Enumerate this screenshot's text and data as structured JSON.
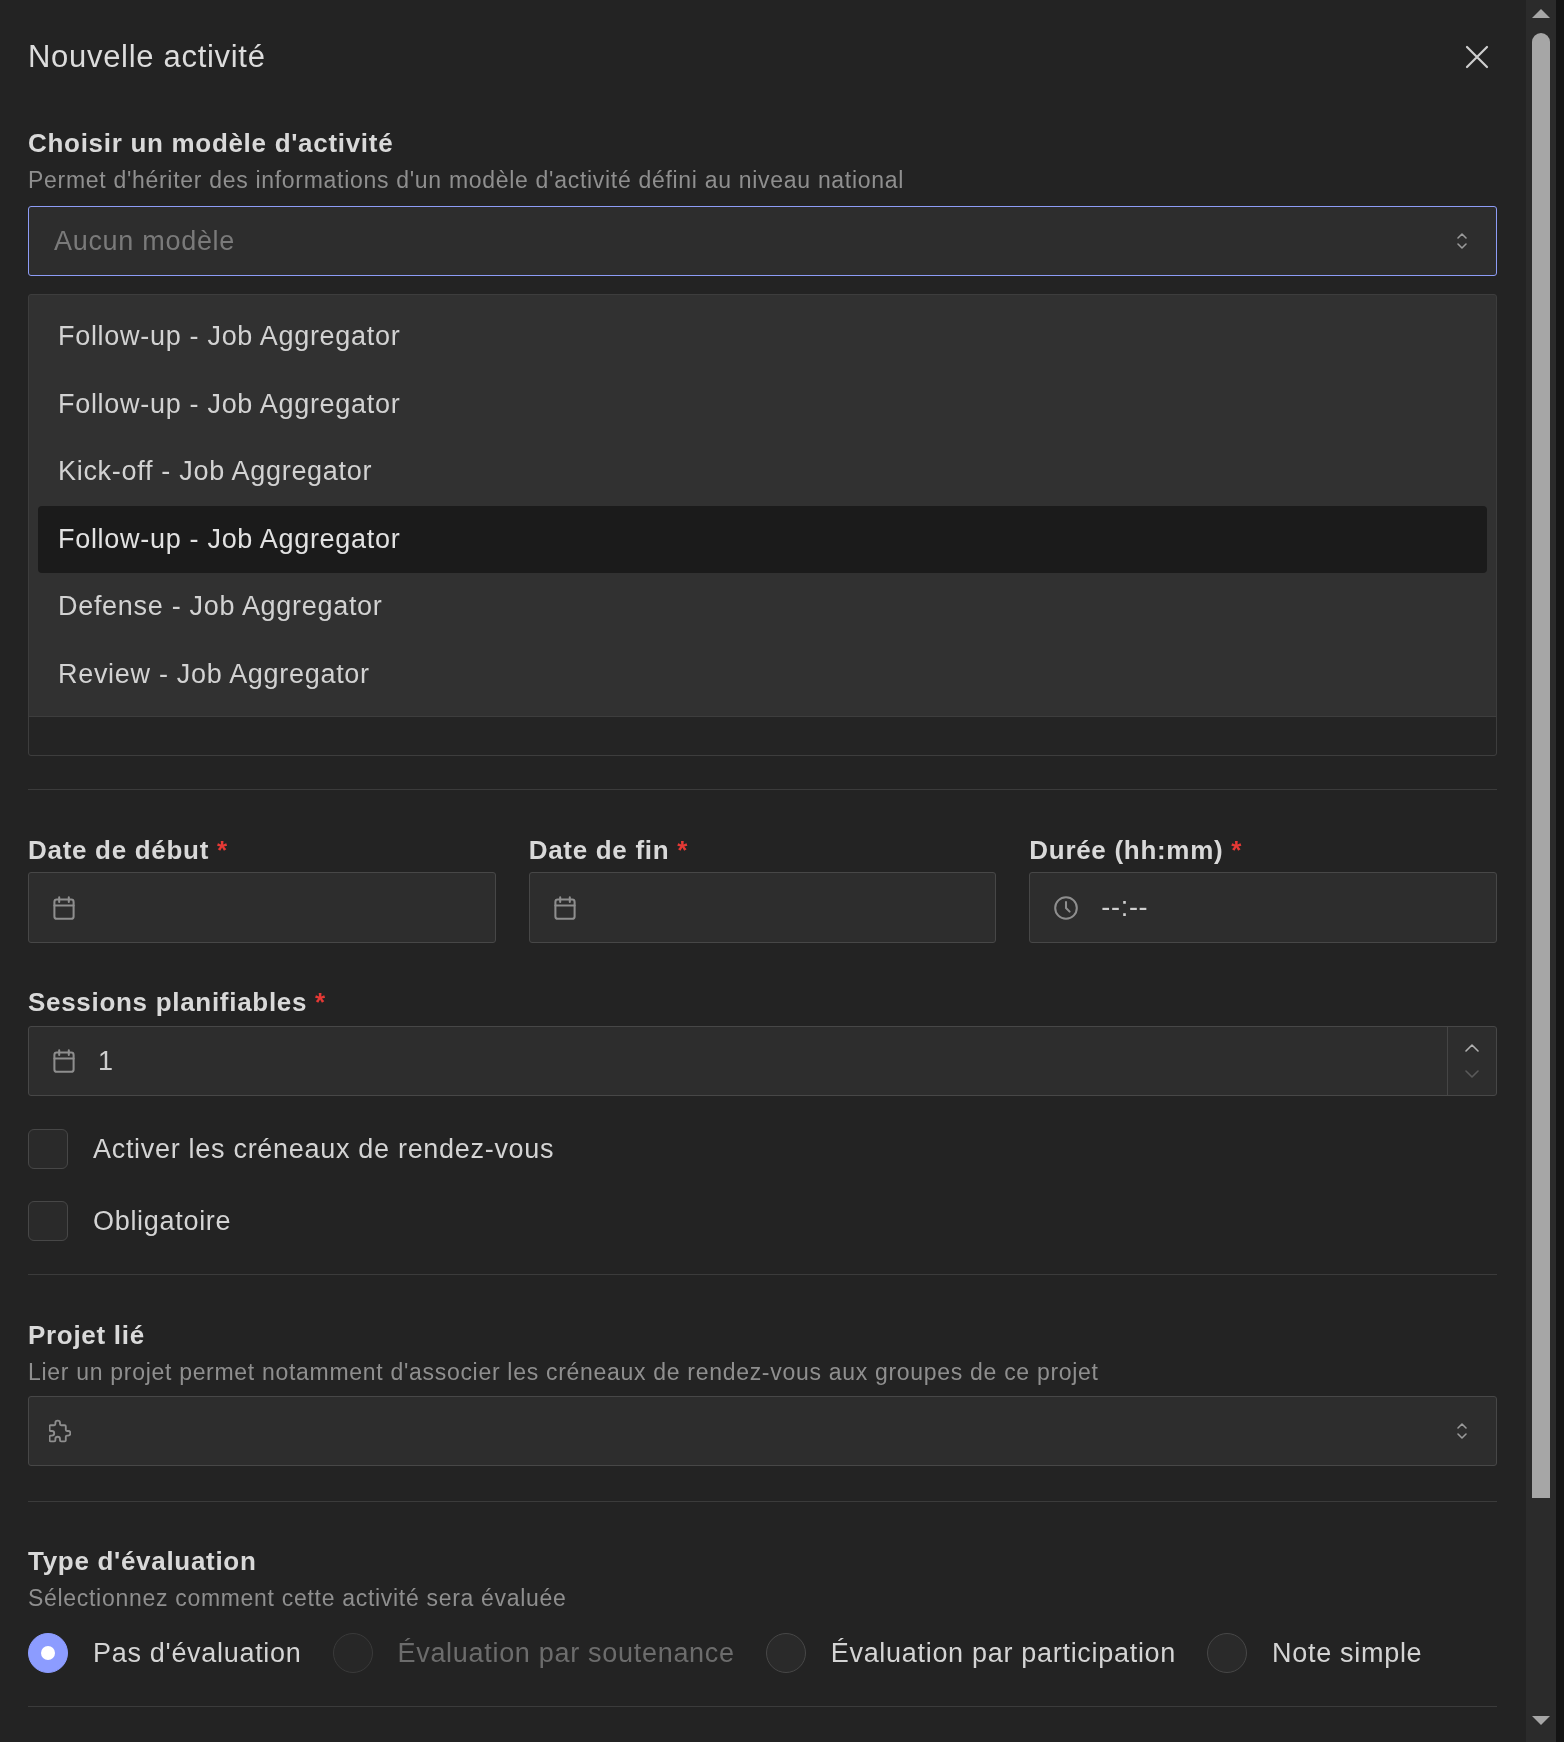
{
  "dialog": {
    "title": "Nouvelle activité"
  },
  "template": {
    "label": "Choisir un modèle d'activité",
    "description": "Permet d'hériter des informations d'un modèle d'activité défini au niveau national",
    "select": {
      "placeholder": "Aucun modèle",
      "focused": true
    },
    "options": [
      {
        "label": "Follow-up - Job Aggregator",
        "highlighted": false
      },
      {
        "label": "Follow-up - Job Aggregator",
        "highlighted": false
      },
      {
        "label": "Kick-off - Job Aggregator",
        "highlighted": false
      },
      {
        "label": "Follow-up - Job Aggregator",
        "highlighted": true
      },
      {
        "label": "Defense - Job Aggregator",
        "highlighted": false
      },
      {
        "label": "Review - Job Aggregator",
        "highlighted": false
      }
    ]
  },
  "schedule": {
    "fields": [
      {
        "kind": "date",
        "label": "Date de début",
        "required_mark": "*"
      },
      {
        "kind": "date",
        "label": "Date de fin",
        "required_mark": "*"
      },
      {
        "kind": "time",
        "label": "Durée (hh:mm)",
        "required_mark": "*",
        "value": "--:--"
      }
    ]
  },
  "sessions": {
    "label": "Sessions planifiables",
    "required_mark": "*",
    "value": "1",
    "increment_disabled": false,
    "decrement_disabled": true
  },
  "checkboxes": [
    {
      "label": "Activer les créneaux de rendez-vous",
      "checked": false
    },
    {
      "label": "Obligatoire",
      "checked": false
    }
  ],
  "project": {
    "label": "Projet lié",
    "description": "Lier un projet permet notamment d'associer les créneaux de rendez-vous aux groupes de ce projet",
    "select": {
      "focused": false
    }
  },
  "evaluation": {
    "label": "Type d'évaluation",
    "description": "Sélectionnez comment cette activité sera évaluée",
    "options": [
      {
        "label": "Pas d'évaluation",
        "selected": true,
        "disabled": false
      },
      {
        "label": "Évaluation par soutenance",
        "selected": false,
        "disabled": true
      },
      {
        "label": "Évaluation par participation",
        "selected": false,
        "disabled": false
      },
      {
        "label": "Note simple",
        "selected": false,
        "disabled": false
      }
    ]
  }
}
